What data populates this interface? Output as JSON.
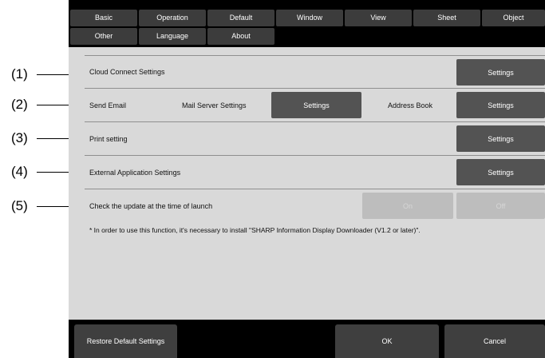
{
  "callouts": [
    "(1)",
    "(2)",
    "(3)",
    "(4)",
    "(5)"
  ],
  "tabs_row1": [
    "Basic",
    "Operation",
    "Default",
    "Window",
    "View",
    "Sheet",
    "Object"
  ],
  "tabs_row2": [
    "Other",
    "Language",
    "About"
  ],
  "rows": {
    "cloud": {
      "label": "Cloud Connect Settings",
      "button": "Settings"
    },
    "email": {
      "label": "Send Email",
      "mail_server_label": "Mail Server Settings",
      "mail_server_button": "Settings",
      "address_label": "Address Book",
      "address_button": "Settings"
    },
    "print": {
      "label": "Print setting",
      "button": "Settings"
    },
    "external": {
      "label": "External Application Settings",
      "button": "Settings"
    },
    "update": {
      "label": "Check the update at the time of launch",
      "on": "On",
      "off": "Off"
    }
  },
  "note": "* In order to use this function, it's necessary to install \"SHARP Information Display Downloader (V1.2 or later)\".",
  "footer": {
    "restore": "Restore Default Settings",
    "ok": "OK",
    "cancel": "Cancel"
  },
  "colors": {
    "tab": "#3c3c3c",
    "button": "#535353",
    "panel": "#d9d9d9",
    "disabled": "#bdbdbd"
  }
}
